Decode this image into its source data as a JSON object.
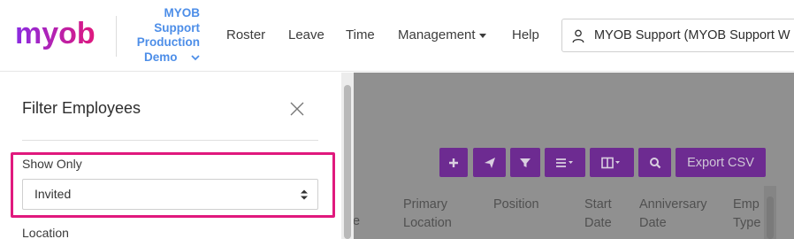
{
  "header": {
    "logo_text": "myob",
    "business_name_lines": [
      "MYOB",
      "Support",
      "Production",
      "Demo"
    ],
    "nav": {
      "roster": "Roster",
      "leave": "Leave",
      "time": "Time",
      "management": "Management",
      "help": "Help"
    },
    "user_label": "MYOB Support (MYOB Support W"
  },
  "toolbar": {
    "export_label": "Export CSV",
    "icons": [
      "plus-icon",
      "send-icon",
      "filter-icon",
      "list-menu-icon",
      "columns-icon",
      "search-icon"
    ]
  },
  "table": {
    "headers": [
      {
        "line1": "Primary",
        "line2": "Location"
      },
      {
        "line1": "Position",
        "line2": ""
      },
      {
        "line1": "Start",
        "line2": "Date"
      },
      {
        "line1": "Anniversary",
        "line2": "Date"
      },
      {
        "line1": "Emp",
        "line2": "Type"
      }
    ],
    "cut_header": "e"
  },
  "filter_panel": {
    "title": "Filter Employees",
    "show_only": {
      "label": "Show Only",
      "value": "Invited"
    },
    "location": {
      "label": "Location"
    }
  },
  "colors": {
    "brand_purple": "#6d2b91",
    "logo_gradient_start": "#8a2be2",
    "logo_gradient_end": "#e0197d",
    "link_blue": "#4d8ee8",
    "highlight_pink": "#e0197d"
  }
}
